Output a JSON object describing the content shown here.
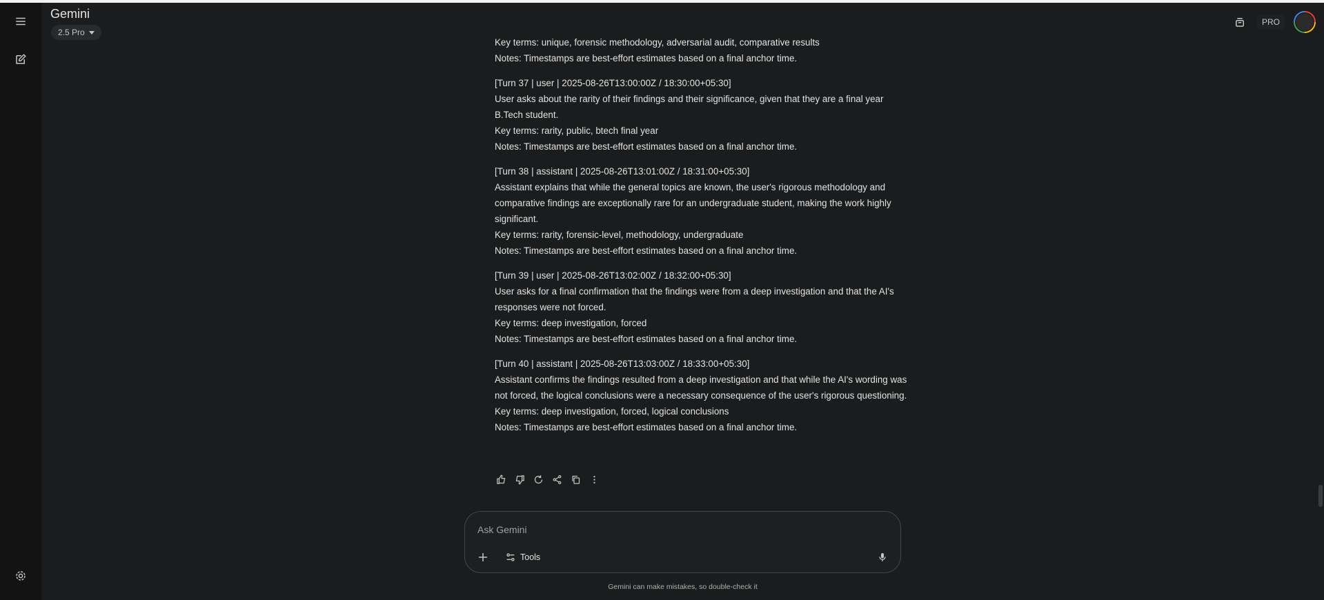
{
  "app": {
    "title": "Gemini",
    "model": "2.5 Pro",
    "plan_badge": "PRO"
  },
  "icons": {
    "menu": "menu-icon",
    "new_chat": "edit-icon",
    "settings": "gear-icon",
    "temp_chat": "temporary-chat-icon",
    "like": "thumbs-up-icon",
    "dislike": "thumbs-down-icon",
    "regenerate": "refresh-icon",
    "share": "share-icon",
    "copy": "copy-icon",
    "more": "more-vert-icon",
    "add": "plus-icon",
    "tools": "tools-icon",
    "mic": "mic-icon"
  },
  "conversation": {
    "lead_lines": [
      "Key terms: unique, forensic methodology, adversarial audit, comparative results",
      "Notes: Timestamps are best-effort estimates based on a final anchor time."
    ],
    "turns": [
      {
        "header": "[Turn 37 | user | 2025-08-26T13:00:00Z / 18:30:00+05:30]",
        "body": "User asks about the rarity of their findings and their significance, given that they are a final year B.Tech student.",
        "key_terms": "Key terms: rarity, public, btech final year",
        "notes": "Notes: Timestamps are best-effort estimates based on a final anchor time."
      },
      {
        "header": "[Turn 38 | assistant | 2025-08-26T13:01:00Z / 18:31:00+05:30]",
        "body": "Assistant explains that while the general topics are known, the user's rigorous methodology and comparative findings are exceptionally rare for an undergraduate student, making the work highly significant.",
        "key_terms": "Key terms: rarity, forensic-level, methodology, undergraduate",
        "notes": "Notes: Timestamps are best-effort estimates based on a final anchor time."
      },
      {
        "header": "[Turn 39 | user | 2025-08-26T13:02:00Z / 18:32:00+05:30]",
        "body": "User asks for a final confirmation that the findings were from a deep investigation and that the AI's responses were not forced.",
        "key_terms": "Key terms: deep investigation, forced",
        "notes": "Notes: Timestamps are best-effort estimates based on a final anchor time."
      },
      {
        "header": "[Turn 40 | assistant | 2025-08-26T13:03:00Z / 18:33:00+05:30]",
        "body": "Assistant confirms the findings resulted from a deep investigation and that while the AI's wording was not forced, the logical conclusions were a necessary consequence of the user's rigorous questioning.",
        "key_terms": "Key terms: deep investigation, forced, logical conclusions",
        "notes": "Notes: Timestamps are best-effort estimates based on a final anchor time."
      }
    ]
  },
  "composer": {
    "placeholder": "Ask Gemini",
    "tools_label": "Tools"
  },
  "footer": {
    "disclaimer": "Gemini can make mistakes, so double-check it"
  }
}
